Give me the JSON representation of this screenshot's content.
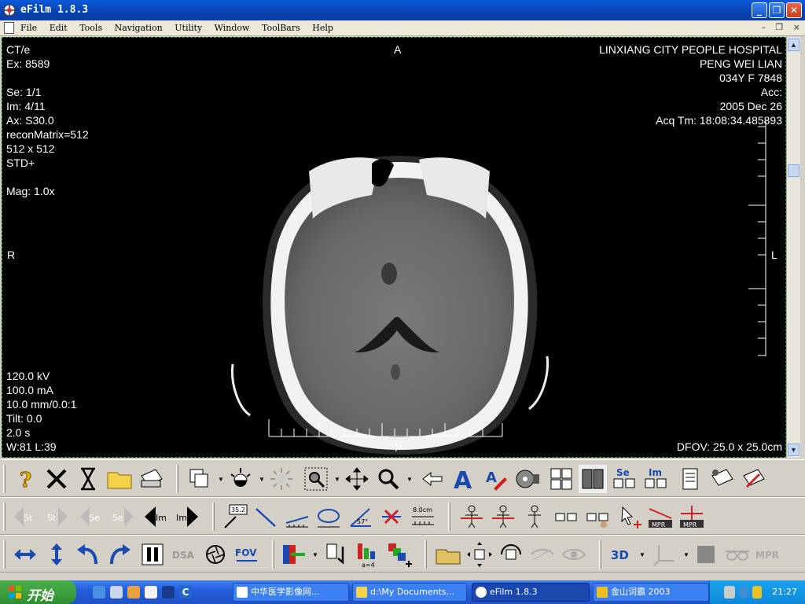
{
  "window": {
    "title": "eFilm 1.8.3",
    "buttons": {
      "minimize": "_",
      "restore": "❐",
      "close": "✕"
    }
  },
  "menu": {
    "items": [
      "File",
      "Edit",
      "Tools",
      "Navigation",
      "Utility",
      "Window",
      "ToolBars",
      "Help"
    ],
    "mdi_buttons": [
      "–",
      "❐",
      "×"
    ]
  },
  "overlay": {
    "top_left": [
      "CT/e",
      "Ex: 8589",
      "",
      "Se: 1/1",
      "Im: 4/11",
      "Ax: S30.0",
      "reconMatrix=512",
      "512 x 512",
      "STD+",
      "",
      "Mag: 1.0x"
    ],
    "top_right": [
      "LINXIANG CITY PEOPLE HOSPITAL",
      "PENG WEI LIAN",
      "034Y  F  7848",
      "Acc:",
      "2005 Dec 26",
      "Acq Tm: 18:08:34.485893"
    ],
    "bottom_left": [
      "120.0 kV",
      "100.0 mA",
      "10.0 mm/0.0:1",
      "Tilt: 0.0",
      "2.0 s",
      "W:81  L:39"
    ],
    "bottom_right": "DFOV: 25.0 x 25.0cm",
    "orient_top": "A",
    "orient_left": "R",
    "orient_right": "L",
    "orient_bottom": "P"
  },
  "toolbar": {
    "row3_labels": {
      "dsa": "DSA",
      "fov": "FOV",
      "a4": "a=4",
      "three_d": "3D",
      "mpr": "MPR"
    },
    "row2_labels": {
      "st": "St",
      "se": "Se",
      "im": "Im",
      "ruler": "8.0cm",
      "angle": "35.2",
      "deg": "57°",
      "mpr": "MPR"
    },
    "row1_labels": {
      "se": "Se",
      "im": "Im"
    }
  },
  "taskbar": {
    "start_label": "开始",
    "tasks": [
      {
        "label": "中华医学影像网...",
        "active": false
      },
      {
        "label": "d:\\My Documents...",
        "active": false
      },
      {
        "label": "eFilm 1.8.3",
        "active": true
      },
      {
        "label": "金山词霸 2003",
        "active": false
      }
    ],
    "clock": "21:27"
  },
  "colors": {
    "title_blue": "#0842b0",
    "viewer_bg": "#000000",
    "overlay_text": "#ffffff",
    "start_green": "#2f8d2f",
    "toolbar_bg": "#d4d0c8"
  }
}
